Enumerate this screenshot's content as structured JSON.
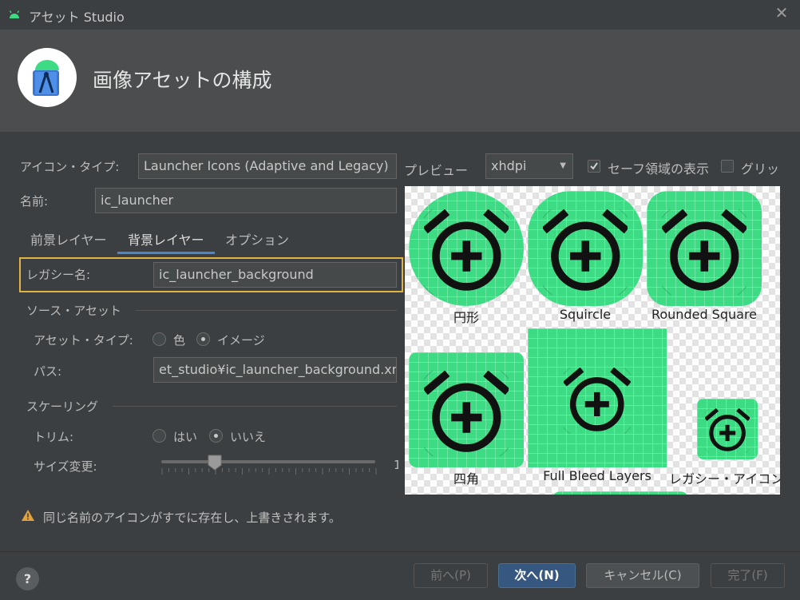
{
  "window": {
    "title": "アセット Studio",
    "close_label": "✕"
  },
  "header": {
    "title": "画像アセットの構成"
  },
  "icon_type": {
    "label": "アイコン・タイプ:",
    "value": "Launcher Icons (Adaptive and Legacy)"
  },
  "name": {
    "label": "名前:",
    "value": "ic_launcher"
  },
  "tabs": [
    {
      "label": "前景レイヤー",
      "active": false
    },
    {
      "label": "背景レイヤー",
      "active": true
    },
    {
      "label": "オプション",
      "active": false
    }
  ],
  "legacy_name": {
    "label": "レガシー名:",
    "value": "ic_launcher_background"
  },
  "source_asset": {
    "section_label": "ソース・アセット",
    "asset_type_label": "アセット・タイプ:",
    "options": [
      {
        "label": "色",
        "selected": false
      },
      {
        "label": "イメージ",
        "selected": true
      }
    ],
    "path_label": "パス:",
    "path_value": "et_studio¥ic_launcher_background.xm"
  },
  "scaling": {
    "section_label": "スケーリング",
    "trim_label": "トリム:",
    "trim_options": [
      {
        "label": "はい",
        "selected": false
      },
      {
        "label": "いいえ",
        "selected": true
      }
    ],
    "resize_label": "サイズ変更:",
    "resize_fraction": 0.25,
    "resize_value_cut": "1"
  },
  "warning": {
    "icon": "warning-icon",
    "text": "同じ名前のアイコンがすでに存在し、上書きされます。"
  },
  "preview": {
    "label": "プレビュー",
    "density": "xhdpi",
    "safe_zone": {
      "label": "セーフ領域の表示",
      "checked": true
    },
    "grid": {
      "label": "グリッ",
      "checked": false
    },
    "icons": [
      {
        "caption": "円形",
        "shape": "circle"
      },
      {
        "caption": "Squircle",
        "shape": "squircle"
      },
      {
        "caption": "Rounded Square",
        "shape": "rounded-square"
      },
      {
        "caption": "四角",
        "shape": "square"
      },
      {
        "caption": "Full Bleed Layers",
        "shape": "full-bleed"
      },
      {
        "caption": "レガシー・アイコン",
        "shape": "legacy"
      }
    ],
    "icon_color": "#3ddc84",
    "glyph": "alarm-add-icon"
  },
  "footer": {
    "help_label": "?",
    "prev": "前へ(P)",
    "next": "次へ(N)",
    "cancel": "キャンセル(C)",
    "finish": "完了(F)"
  },
  "colors": {
    "accent": "#4a88c7",
    "highlight": "#e3b341",
    "warning": "#e3a23c"
  }
}
